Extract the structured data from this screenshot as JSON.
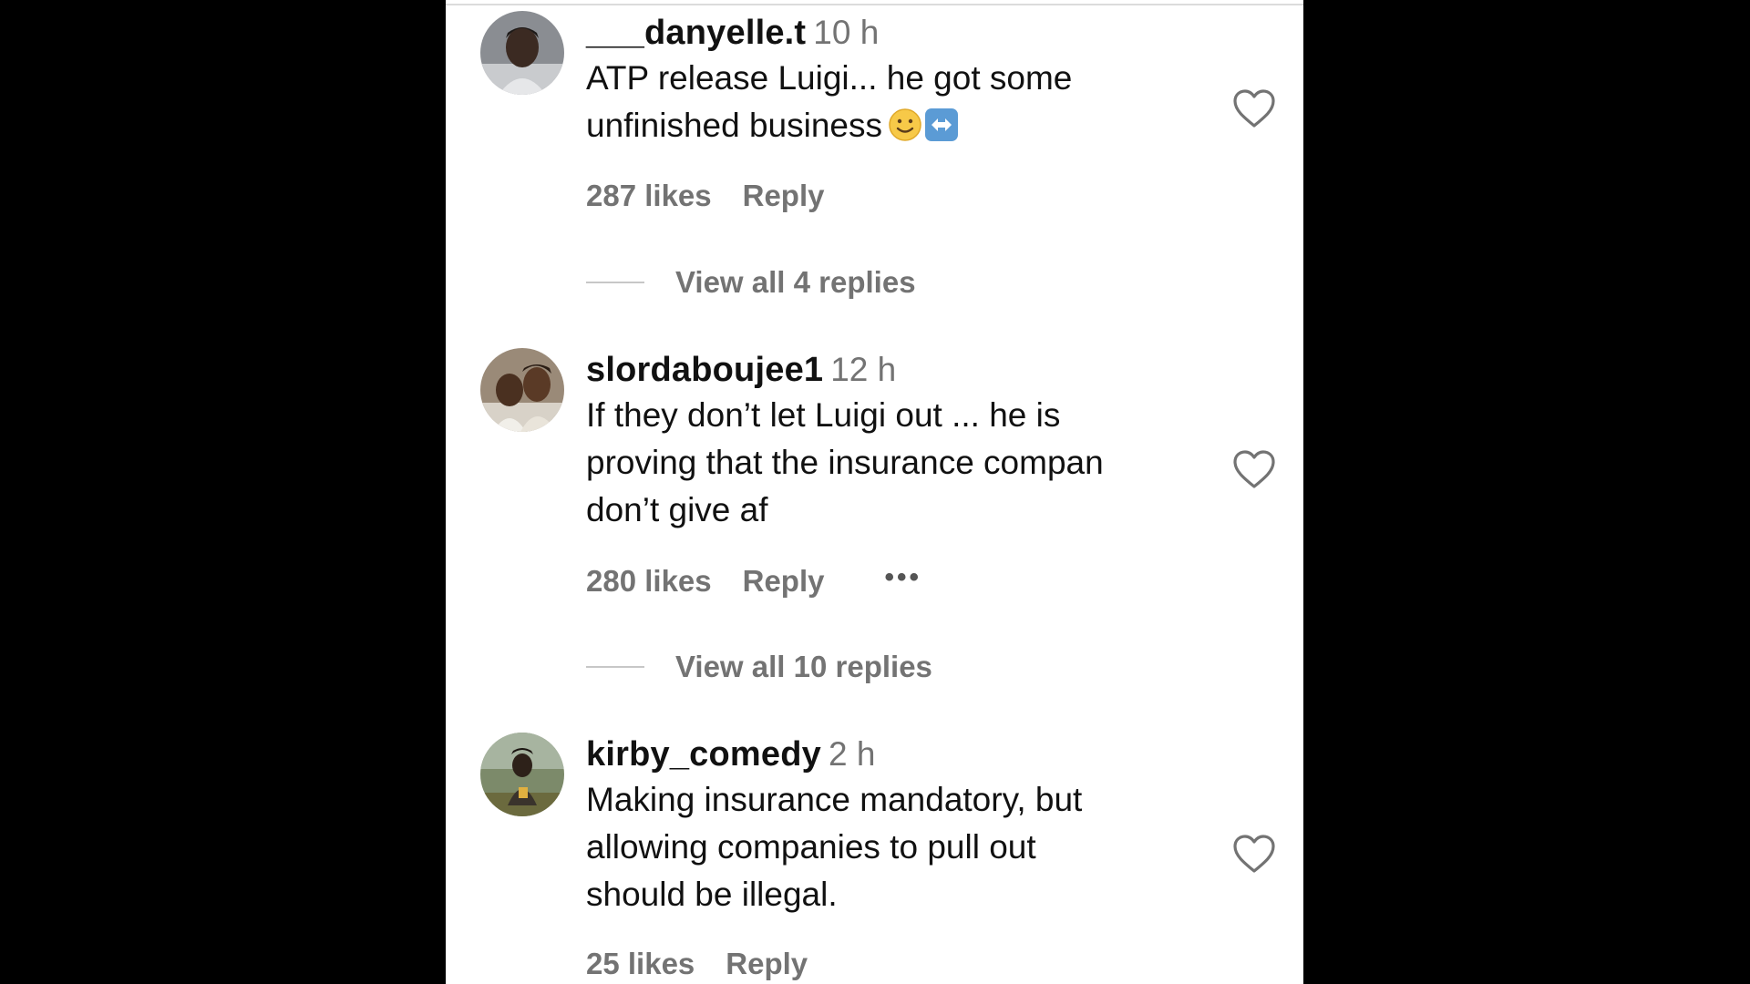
{
  "comments": [
    {
      "username": "___danyelle.t",
      "time": "10 h",
      "text": "ATP release Luigi... he got some\nunfinished business",
      "emojis": [
        "slightly-smiling-face",
        "left-right-arrow"
      ],
      "likes": "287 likes",
      "reply_label": "Reply",
      "view_replies": "View all 4 replies"
    },
    {
      "username": "slordaboujee1",
      "time": "12 h",
      "text": "If they don’t let Luigi out ... he is\nproving that the insurance compan\ndon’t give af",
      "likes": "280 likes",
      "reply_label": "Reply",
      "more_label": "•••",
      "view_replies": "View all 10 replies"
    },
    {
      "username": "kirby_comedy",
      "time": "2 h",
      "text": "Making insurance mandatory, but\nallowing companies to pull out\nshould be illegal.",
      "likes": "25 likes",
      "reply_label": "Reply"
    }
  ],
  "icons": {
    "like": "heart-outline-icon",
    "more": "more-options-icon"
  },
  "colors": {
    "background": "#000000",
    "panel": "#ffffff",
    "primary_text": "#111111",
    "secondary_text": "#737373"
  }
}
